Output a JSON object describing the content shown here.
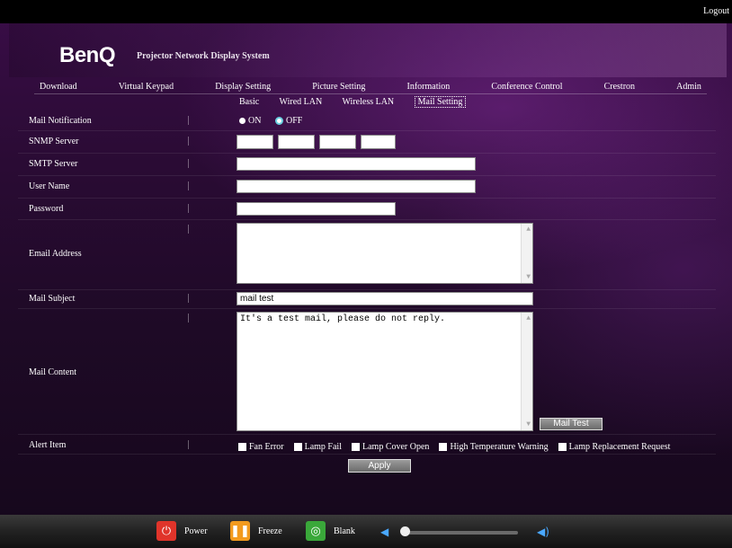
{
  "top": {
    "logout": "Logout"
  },
  "brand": {
    "logo": "BenQ",
    "system_title": "Projector Network Display System"
  },
  "main_nav": [
    "Download",
    "Virtual Keypad",
    "Display Setting",
    "Picture Setting",
    "Information",
    "Conference Control",
    "Crestron",
    "Admin"
  ],
  "sub_nav": {
    "items": [
      "Basic",
      "Wired LAN",
      "Wireless LAN",
      "Mail Setting"
    ],
    "active": "Mail Setting"
  },
  "form": {
    "mail_notification": {
      "label": "Mail Notification",
      "on": "ON",
      "off": "OFF",
      "selected": "OFF"
    },
    "snmp_server": {
      "label": "SNMP Server",
      "octets": [
        "",
        "",
        "",
        ""
      ]
    },
    "smtp_server": {
      "label": "SMTP Server",
      "value": ""
    },
    "user_name": {
      "label": "User Name",
      "value": ""
    },
    "password": {
      "label": "Password",
      "value": ""
    },
    "email_address": {
      "label": "Email Address",
      "value": ""
    },
    "mail_subject": {
      "label": "Mail Subject",
      "value": "mail test"
    },
    "mail_content": {
      "label": "Mail Content",
      "value": "It's a test mail, please do not reply."
    },
    "mail_test_button": "Mail Test",
    "alert_item": {
      "label": "Alert Item",
      "options": [
        "Fan Error",
        "Lamp Fail",
        "Lamp Cover Open",
        "High Temperature Warning",
        "Lamp Replacement Request"
      ]
    },
    "apply_button": "Apply"
  },
  "controls": {
    "power": "Power",
    "freeze": "Freeze",
    "blank": "Blank"
  },
  "colors": {
    "power": "#e0342a",
    "freeze": "#f29a1e",
    "blank": "#3aa83a",
    "volume": "#4aa8ff"
  }
}
